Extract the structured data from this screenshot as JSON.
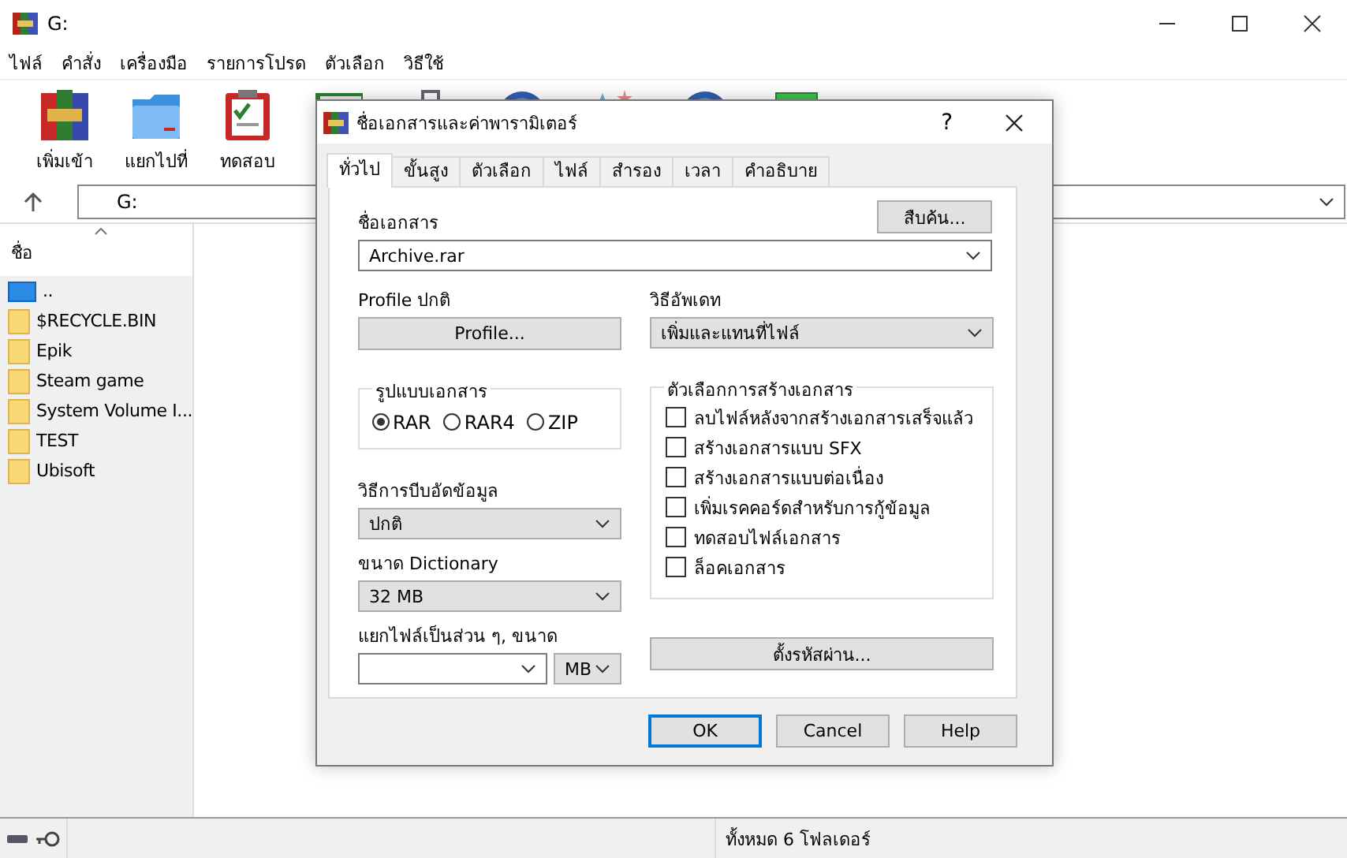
{
  "window": {
    "title": "G:"
  },
  "menu": [
    "ไฟล์",
    "คำสั่ง",
    "เครื่องมือ",
    "รายการโปรด",
    "ตัวเลือก",
    "วิธีใช้"
  ],
  "toolbar": [
    {
      "kind": "books",
      "label": "เพิ่มเข้า"
    },
    {
      "kind": "folder",
      "label": "แยกไปที่"
    },
    {
      "kind": "clipboard",
      "label": "ทดสอบ"
    },
    {
      "kind": "book"
    },
    {
      "kind": "case"
    },
    {
      "kind": "globe"
    },
    {
      "kind": "stars"
    },
    {
      "kind": "globe"
    },
    {
      "kind": "green"
    }
  ],
  "address": {
    "value": "G:"
  },
  "file_list": {
    "column": "ชื่อ",
    "items": [
      {
        "kind": "up",
        "name": ".."
      },
      {
        "kind": "folder",
        "name": "$RECYCLE.BIN"
      },
      {
        "kind": "folder",
        "name": "Epik"
      },
      {
        "kind": "folder",
        "name": "Steam game"
      },
      {
        "kind": "folder",
        "name": "System Volume I..."
      },
      {
        "kind": "folder",
        "name": "TEST"
      },
      {
        "kind": "folder",
        "name": "Ubisoft"
      }
    ]
  },
  "status_bar": {
    "text": "ทั้งหมด 6 โฟลเดอร์"
  },
  "dialog": {
    "title": "ชื่อเอกสารและค่าพารามิเตอร์",
    "help": "?",
    "tabs": [
      {
        "label": "ทั่วไป",
        "selected": true
      },
      {
        "label": "ขั้นสูง",
        "selected": false
      },
      {
        "label": "ตัวเลือก",
        "selected": false
      },
      {
        "label": "ไฟล์",
        "selected": false
      },
      {
        "label": "สำรอง",
        "selected": false
      },
      {
        "label": "เวลา",
        "selected": false
      },
      {
        "label": "คำอธิบาย",
        "selected": false
      }
    ],
    "archive_label": "ชื่อเอกสาร",
    "browse_button": "สืบค้น...",
    "archive_name": "Archive.rar",
    "profile_label": "Profile ปกติ",
    "profile_button": "Profile...",
    "update_label": "วิธีอัพเดท",
    "update_mode": "เพิ่มและแทนที่ไฟล์",
    "format_label": "รูปแบบเอกสาร",
    "formats": [
      {
        "label": "RAR",
        "selected": true
      },
      {
        "label": "RAR4",
        "selected": false
      },
      {
        "label": "ZIP",
        "selected": false
      }
    ],
    "compression_label": "วิธีการบีบอัดข้อมูล",
    "compression": "ปกติ",
    "dictionary_label": "ขนาด Dictionary",
    "dictionary": "32 MB",
    "split_label": "แยกไฟล์เป็นส่วน ๆ, ขนาด",
    "split_unit": "MB",
    "options_label": "ตัวเลือกการสร้างเอกสาร",
    "options": [
      {
        "label": "ลบไฟล์หลังจากสร้างเอกสารเสร็จแล้ว",
        "checked": false
      },
      {
        "label": "สร้างเอกสารแบบ SFX",
        "checked": false
      },
      {
        "label": "สร้างเอกสารแบบต่อเนื่อง",
        "checked": false
      },
      {
        "label": "เพิ่มเรคคอร์ดสำหรับการกู้ข้อมูล",
        "checked": false
      },
      {
        "label": "ทดสอบไฟล์เอกสาร",
        "checked": false
      },
      {
        "label": "ล็อคเอกสาร",
        "checked": false
      }
    ],
    "password_button": "ตั้งรหัสผ่าน...",
    "buttons": [
      {
        "label": "OK",
        "selected": true
      },
      {
        "label": "Cancel",
        "selected": false
      },
      {
        "label": "Help",
        "selected": false
      }
    ]
  }
}
